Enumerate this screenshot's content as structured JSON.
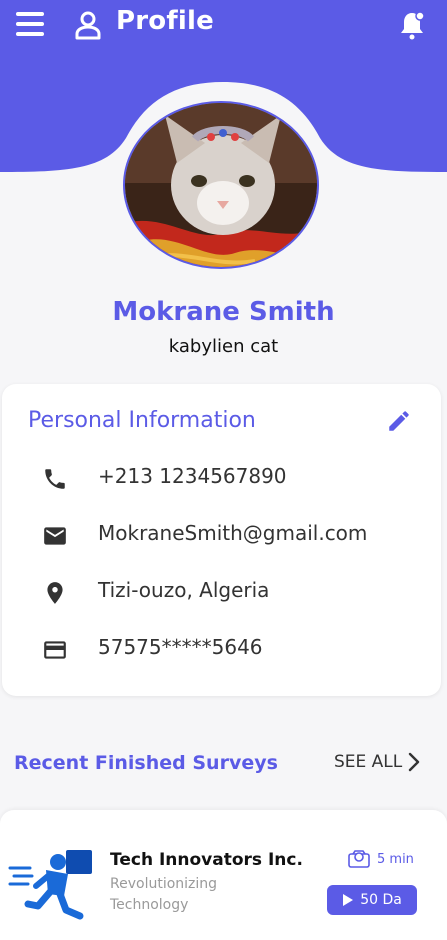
{
  "header": {
    "title": "Profile",
    "accent": "#5b5be6",
    "icons": [
      "menu-icon",
      "user-icon",
      "bell-icon"
    ]
  },
  "profile": {
    "name": "Mokrane Smith",
    "subtitle": "kabylien cat"
  },
  "personal_info": {
    "title": "Personal Information",
    "rows": [
      {
        "icon": "phone-icon",
        "value": "+213 1234567890"
      },
      {
        "icon": "mail-icon",
        "value": "MokraneSmith@gmail.com"
      },
      {
        "icon": "location-icon",
        "value": "Tizi-ouzo, Algeria"
      },
      {
        "icon": "card-icon",
        "value": "57575*****5646"
      }
    ]
  },
  "recent": {
    "title": "Recent Finished Surveys",
    "see_all": "SEE ALL"
  },
  "survey": {
    "company": "Tech Innovators Inc.",
    "desc_line1": "Revolutionizing",
    "desc_line2": "Technology",
    "duration": "5 min",
    "reward": "50 Da"
  }
}
